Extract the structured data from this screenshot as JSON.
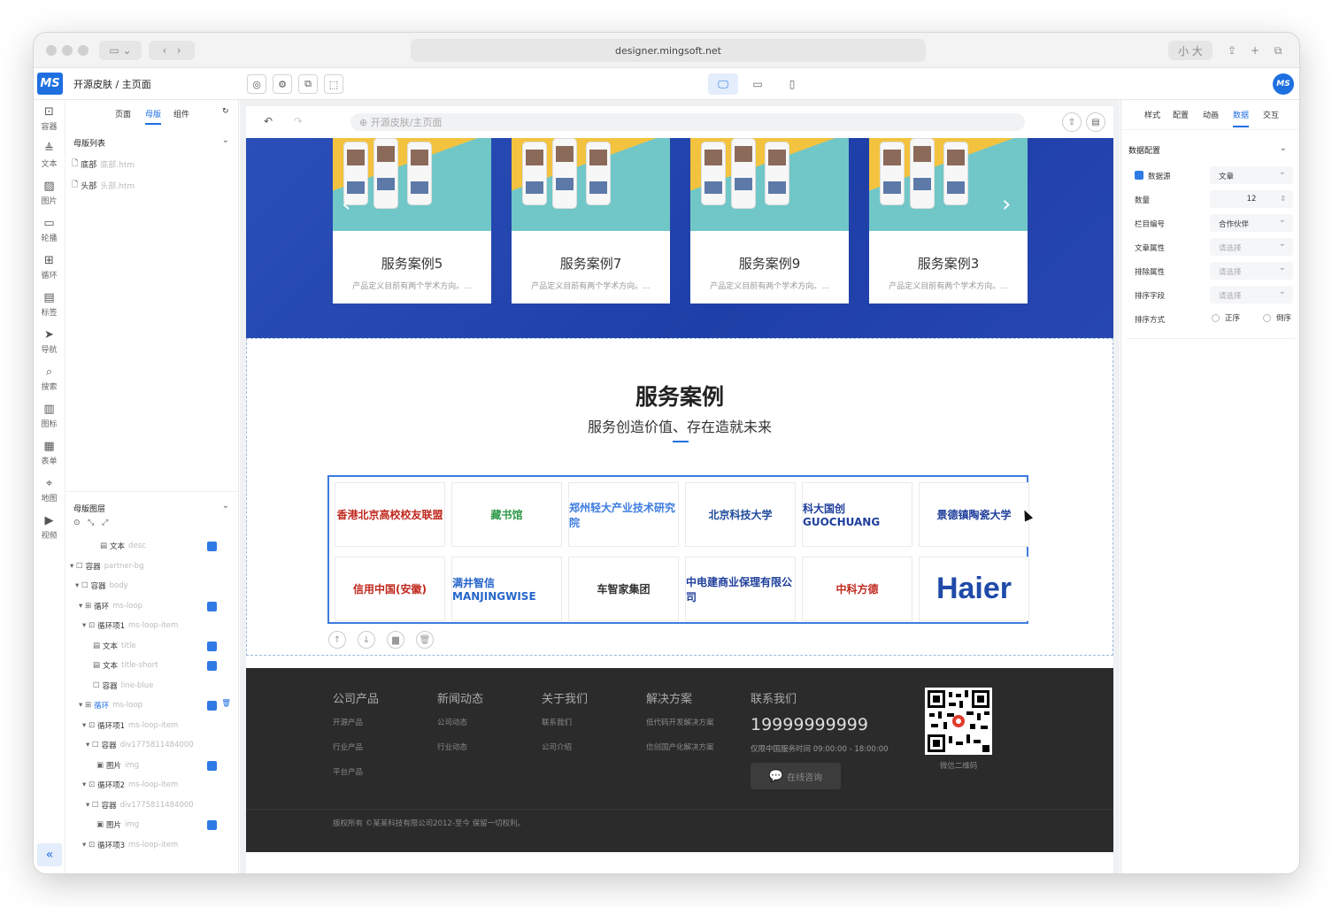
{
  "browser": {
    "url": "designer.mingsoft.net"
  },
  "app": {
    "logo": "MS",
    "title": "开源皮肤 / 主页面",
    "avatar": "MS"
  },
  "left_toolbar": [
    {
      "label": "容器",
      "icon": "container-icon"
    },
    {
      "label": "文本",
      "icon": "text-icon"
    },
    {
      "label": "图片",
      "icon": "image-icon"
    },
    {
      "label": "轮播",
      "icon": "carousel-icon"
    },
    {
      "label": "循环",
      "icon": "loop-icon"
    },
    {
      "label": "标签",
      "icon": "tag-icon"
    },
    {
      "label": "导航",
      "icon": "nav-icon"
    },
    {
      "label": "搜索",
      "icon": "search-icon"
    },
    {
      "label": "图标",
      "icon": "icon-icon"
    },
    {
      "label": "表单",
      "icon": "form-icon"
    },
    {
      "label": "地图",
      "icon": "map-icon"
    },
    {
      "label": "视频",
      "icon": "video-icon"
    }
  ],
  "left_panel": {
    "tabs": [
      "页面",
      "母版",
      "组件"
    ],
    "active_tab": "母版",
    "master_list_title": "母版列表",
    "masters": [
      {
        "name": "底部",
        "file": "底部.htm"
      },
      {
        "name": "头部",
        "file": "头部.htm"
      }
    ],
    "layers_title": "母版图层",
    "layers": [
      {
        "type": "文本",
        "cls": "desc",
        "indent": 38,
        "icon": "▤",
        "badge": true
      },
      {
        "type": "容器",
        "cls": "partner-bg",
        "indent": 4,
        "icon": "▾ ☐",
        "badge": false
      },
      {
        "type": "容器",
        "cls": "body",
        "indent": 10,
        "icon": "▾ ☐",
        "badge": false
      },
      {
        "type": "循环",
        "cls": "ms-loop",
        "indent": 14,
        "icon": "▾ ⊞",
        "badge": true
      },
      {
        "type": "循环项1",
        "cls": "ms-loop-item",
        "indent": 18,
        "icon": "▾ ⊡",
        "badge": false
      },
      {
        "type": "文本",
        "cls": "title",
        "indent": 30,
        "icon": "▤",
        "badge": true
      },
      {
        "type": "文本",
        "cls": "title-short",
        "indent": 30,
        "icon": "▤",
        "badge": true
      },
      {
        "type": "容器",
        "cls": "line-blue",
        "indent": 30,
        "icon": "☐",
        "badge": false
      },
      {
        "type": "循环",
        "cls": "ms-loop",
        "indent": 14,
        "icon": "▾ ⊞",
        "badge": true,
        "active": true
      },
      {
        "type": "循环项1",
        "cls": "ms-loop-item",
        "indent": 18,
        "icon": "▾ ⊡",
        "badge": false
      },
      {
        "type": "容器",
        "cls": "div1775811484000",
        "indent": 22,
        "icon": "▾ ☐",
        "badge": false
      },
      {
        "type": "图片",
        "cls": "img",
        "indent": 34,
        "icon": "▣",
        "badge": true
      },
      {
        "type": "循环项2",
        "cls": "ms-loop-item",
        "indent": 18,
        "icon": "▾ ⊡",
        "badge": false
      },
      {
        "type": "容器",
        "cls": "div1775811484000",
        "indent": 22,
        "icon": "▾ ☐",
        "badge": false
      },
      {
        "type": "图片",
        "cls": "img",
        "indent": 34,
        "icon": "▣",
        "badge": true
      },
      {
        "type": "循环项3",
        "cls": "ms-loop-item",
        "indent": 18,
        "icon": "▾ ⊡",
        "badge": false
      }
    ]
  },
  "canvas": {
    "breadcrumb": "开源皮肤/主页面",
    "cases": [
      {
        "title": "服务案例5",
        "desc": "产品定义目前有两个学术方向。..."
      },
      {
        "title": "服务案例7",
        "desc": "产品定义目前有两个学术方向。..."
      },
      {
        "title": "服务案例9",
        "desc": "产品定义目前有两个学术方向。..."
      },
      {
        "title": "服务案例3",
        "desc": "产品定义目前有两个学术方向。..."
      }
    ],
    "section_title": "服务案例",
    "section_subtitle": "服务创造价值、存在造就未来",
    "partners": [
      {
        "name": "香港北京高校校友联盟",
        "color": "#c0281e"
      },
      {
        "name": "藏书馆",
        "color": "#2f9a4a"
      },
      {
        "name": "郑州轻大产业技术研究院",
        "color": "#3d7be0"
      },
      {
        "name": "北京科技大学",
        "color": "#1f4a9b"
      },
      {
        "name": "科大国创 GUOCHUANG",
        "color": "#1f3f9b"
      },
      {
        "name": "景德镇陶瓷大学",
        "color": "#1f3f9b"
      },
      {
        "name": "信用中国(安徽)",
        "color": "#c0281e"
      },
      {
        "name": "满井智信 MANJINGWISE",
        "color": "#2565c9"
      },
      {
        "name": "车智家集团",
        "color": "#333333"
      },
      {
        "name": "中电建商业保理有限公司",
        "color": "#1f3f9b"
      },
      {
        "name": "中科方德",
        "color": "#c0281e"
      },
      {
        "name": "Haier",
        "color": "#1f4aa8"
      }
    ],
    "footer": {
      "cols": [
        {
          "title": "公司产品",
          "links": [
            "开源产品",
            "行业产品",
            "平台产品"
          ]
        },
        {
          "title": "新闻动态",
          "links": [
            "公司动态",
            "行业动态"
          ]
        },
        {
          "title": "关于我们",
          "links": [
            "联系我们",
            "公司介绍"
          ]
        },
        {
          "title": "解决方案",
          "links": [
            "低代码开发解决方案",
            "信创国产化解决方案"
          ]
        }
      ],
      "contact_title": "联系我们",
      "phone": "19999999999",
      "hours": "仅限中国服务时间 09:00:00 - 18:00:00",
      "consult": "在线咨询",
      "qr_label": "微信二维码",
      "copyright": "版权所有 ©某某科技有限公司2012-至今 保留一切权利。"
    }
  },
  "right_panel": {
    "tabs": [
      "样式",
      "配置",
      "动画",
      "数据",
      "交互"
    ],
    "active_tab": "数据",
    "section_title": "数据配置",
    "fields": [
      {
        "label": "数据源",
        "value": "文章",
        "placeholder": false,
        "badge": true
      },
      {
        "label": "数量",
        "value": "12",
        "placeholder": false,
        "num": true
      },
      {
        "label": "栏目编号",
        "value": "合作伙伴",
        "placeholder": false
      },
      {
        "label": "文章属性",
        "value": "请选择",
        "placeholder": true
      },
      {
        "label": "排除属性",
        "value": "请选择",
        "placeholder": true
      },
      {
        "label": "排序字段",
        "value": "请选择",
        "placeholder": true
      }
    ],
    "sort_label": "排序方式",
    "sort_options": [
      "正序",
      "倒序"
    ]
  }
}
